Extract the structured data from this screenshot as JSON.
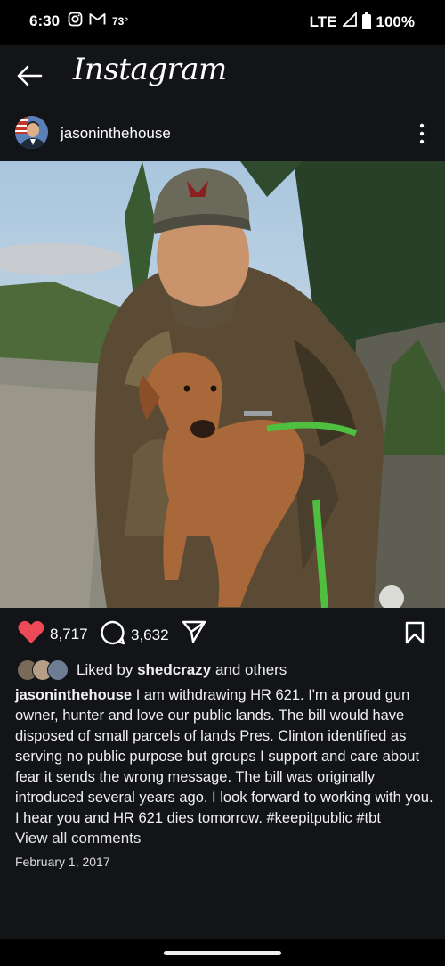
{
  "status_bar": {
    "time": "6:30",
    "temperature": "73°",
    "network": "LTE",
    "battery": "100%"
  },
  "app": {
    "brand": "Instagram"
  },
  "post": {
    "username": "jasoninthehouse",
    "likes_count": "8,717",
    "comments_count": "3,632",
    "liked_by_prefix": "Liked by",
    "liked_by_user": "shedcrazy",
    "liked_by_suffix": "and others",
    "caption_user": "jasoninthehouse",
    "caption_text": "I am withdrawing HR 621. I'm a proud gun owner, hunter and love our public lands. The bill would have disposed of small parcels of lands Pres. Clinton identified as serving no public purpose but groups I support and care about fear it sends the wrong message. The bill was originally introduced several years ago. I look forward to working with you. I hear you and HR 621 dies tomorrow. #keepitpublic #tbt",
    "view_comments": "View all comments",
    "date": "February 1, 2017"
  },
  "colors": {
    "background": "#121417",
    "like_heart": "#ed4956",
    "status_bar": "#000000"
  },
  "icons": [
    "back-arrow-icon",
    "more-vertical-icon",
    "heart-icon",
    "comment-icon",
    "share-icon",
    "bookmark-icon",
    "instagram-icon",
    "gmail-icon"
  ]
}
